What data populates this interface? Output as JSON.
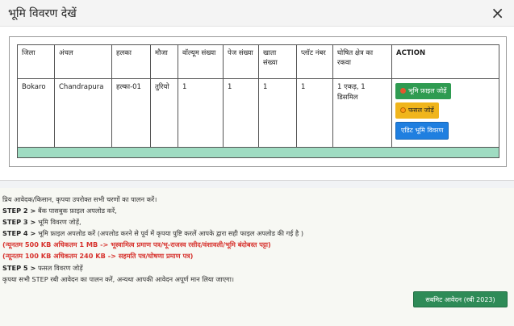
{
  "modal": {
    "title": "भूमि विवरण देखें",
    "close_label": "×"
  },
  "table": {
    "headers": [
      "जिला",
      "अंचल",
      "हलका",
      "मौजा",
      "वॉल्यूम संख्या",
      "पेज संख्या",
      "खाता संख्या",
      "प्लॉट नंबर",
      "घोषित क्षेत्र का रकवा",
      "ACTION"
    ],
    "row": [
      "Bokaro",
      "Chandrapura",
      "हल्का-01",
      "तुरियो",
      "1",
      "1",
      "1",
      "1",
      "1 एकड़, 1 डिसमिल"
    ],
    "actions": {
      "upload_land_file": "भूमि फ़ाइल जोड़ें",
      "add_crop": "फसल जोड़ें",
      "edit_land_details": "एडिट भूमि विवरण"
    }
  },
  "instructions": {
    "intro": "प्रिय आवेदक/किसान, कृपया उपरोक्त सभी चरणों का पालन करें।",
    "steps": [
      {
        "label": "STEP 2 >",
        "text": " बैंक पासबुक फ़ाइल अपलोड करें,"
      },
      {
        "label": "STEP 3 >",
        "text": " भूमि विवरण जोड़ें,"
      },
      {
        "label": "STEP 4 >",
        "text": " भूमि फ़ाइल अपलोड करें (अपलोड करने से पूर्व में कृपया पुष्टि करलें आपके द्वारा सही फाइल अपलोड की गई है )"
      }
    ],
    "note_1": "(न्यूनतम 500 KB अधिकतम 1 MB -> भूस्वामित्व प्रमाण पत्र/भू-राजस्व रसीद/वंशावली/भूमि बंदोबस्त पट्टा)",
    "note_2": "(न्यूनतम 100 KB अधिकतम 240 KB -> सहमति पत्र/घोषणा प्रमाण पत्र)",
    "step5": {
      "label": "STEP 5 >",
      "text": " फसल विवरण जोड़ें"
    },
    "closing": "कृपया सभी STEP रबी आवेदन का पालन करें, अन्यथा आपकी आवेदन अपूर्ण मान लिया जाएगा।"
  },
  "submit_label": "सबमिट आवेदन (रबी 2023)",
  "colors": {
    "green_button": "#2f9b51",
    "yellow_button": "#f0b51c",
    "blue_button": "#1f7fe0",
    "table_footer": "#9fdcc2",
    "warning_text": "#d7342f"
  },
  "icons": {
    "upload_icon": "upload-icon",
    "add_icon": "add-icon",
    "close_icon": "close-icon"
  }
}
